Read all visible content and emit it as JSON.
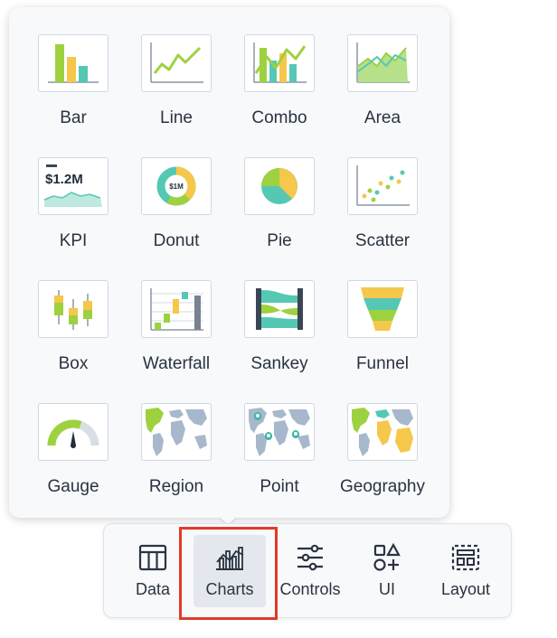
{
  "chart_picker": {
    "tiles": [
      {
        "label": "Bar",
        "icon": "bar-chart-icon"
      },
      {
        "label": "Line",
        "icon": "line-chart-icon"
      },
      {
        "label": "Combo",
        "icon": "combo-chart-icon"
      },
      {
        "label": "Area",
        "icon": "area-chart-icon"
      },
      {
        "label": "KPI",
        "icon": "kpi-icon",
        "value_text": "$1.2M"
      },
      {
        "label": "Donut",
        "icon": "donut-chart-icon",
        "value_text": "$1M"
      },
      {
        "label": "Pie",
        "icon": "pie-chart-icon"
      },
      {
        "label": "Scatter",
        "icon": "scatter-chart-icon"
      },
      {
        "label": "Box",
        "icon": "box-plot-icon"
      },
      {
        "label": "Waterfall",
        "icon": "waterfall-chart-icon"
      },
      {
        "label": "Sankey",
        "icon": "sankey-chart-icon"
      },
      {
        "label": "Funnel",
        "icon": "funnel-chart-icon"
      },
      {
        "label": "Gauge",
        "icon": "gauge-chart-icon"
      },
      {
        "label": "Region",
        "icon": "region-map-icon"
      },
      {
        "label": "Point",
        "icon": "point-map-icon"
      },
      {
        "label": "Geography",
        "icon": "geography-map-icon"
      }
    ]
  },
  "toolbar": {
    "items": [
      {
        "label": "Data",
        "icon": "table-icon"
      },
      {
        "label": "Charts",
        "icon": "charts-icon",
        "active": true
      },
      {
        "label": "Controls",
        "icon": "sliders-icon"
      },
      {
        "label": "UI",
        "icon": "shapes-icon"
      },
      {
        "label": "Layout",
        "icon": "layout-icon"
      }
    ]
  },
  "colors": {
    "green": "#9ed13f",
    "yellow": "#f5c74a",
    "teal": "#55c8b4",
    "gray_land": "#a7b8cc",
    "axis": "#8a96a6",
    "highlight": "#e03b2a"
  }
}
